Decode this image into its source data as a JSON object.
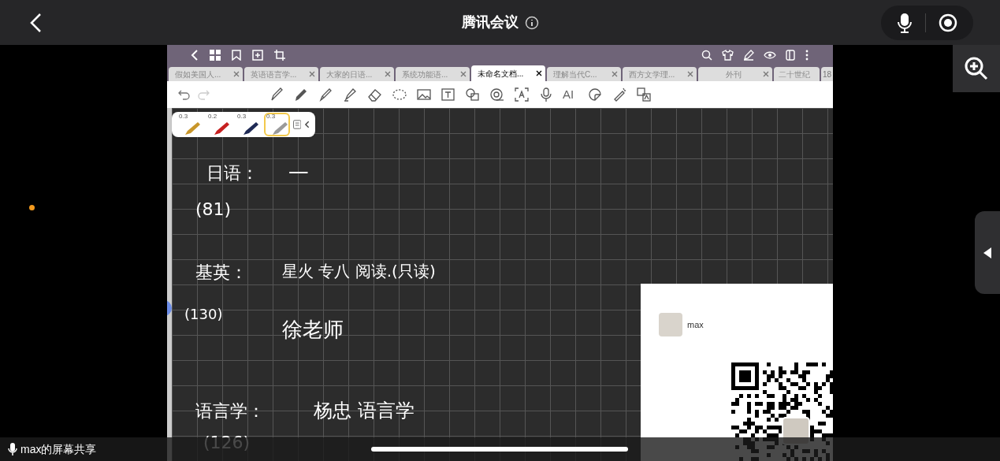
{
  "meeting_bar": {
    "title": "腾讯会议"
  },
  "app_tabs": [
    {
      "label": "假如美国人...",
      "selected": false
    },
    {
      "label": "英语语言学...",
      "selected": false
    },
    {
      "label": "大家的日语...",
      "selected": false
    },
    {
      "label": "系统功能语...",
      "selected": false
    },
    {
      "label": "未命名文档...",
      "selected": true
    },
    {
      "label": "理解当代C...",
      "selected": false
    },
    {
      "label": "西方文学理...",
      "selected": false
    },
    {
      "label": "外刊",
      "selected": false
    },
    {
      "label": "二十世纪",
      "selected": false
    }
  ],
  "tab_count": "18",
  "toolbar": {
    "ai_label": "AI"
  },
  "pens": [
    {
      "size": "0.3",
      "color": "#c8962a",
      "selected": false
    },
    {
      "size": "0.2",
      "color": "#c62020",
      "selected": false
    },
    {
      "size": "0.3",
      "color": "#1f2a55",
      "selected": false
    },
    {
      "size": "0.3",
      "color": "#9a9a9a",
      "selected": true
    }
  ],
  "notes": [
    "日语：",
    "一",
    "(81)",
    "基英：",
    "星火 专八 阅读.(只读)",
    "(130)",
    "徐老师",
    "语言学：",
    "杨忠 语言学",
    "(126)"
  ],
  "qr_card": {
    "name": "max"
  },
  "share_bar": {
    "label": "max的屏幕共享"
  }
}
